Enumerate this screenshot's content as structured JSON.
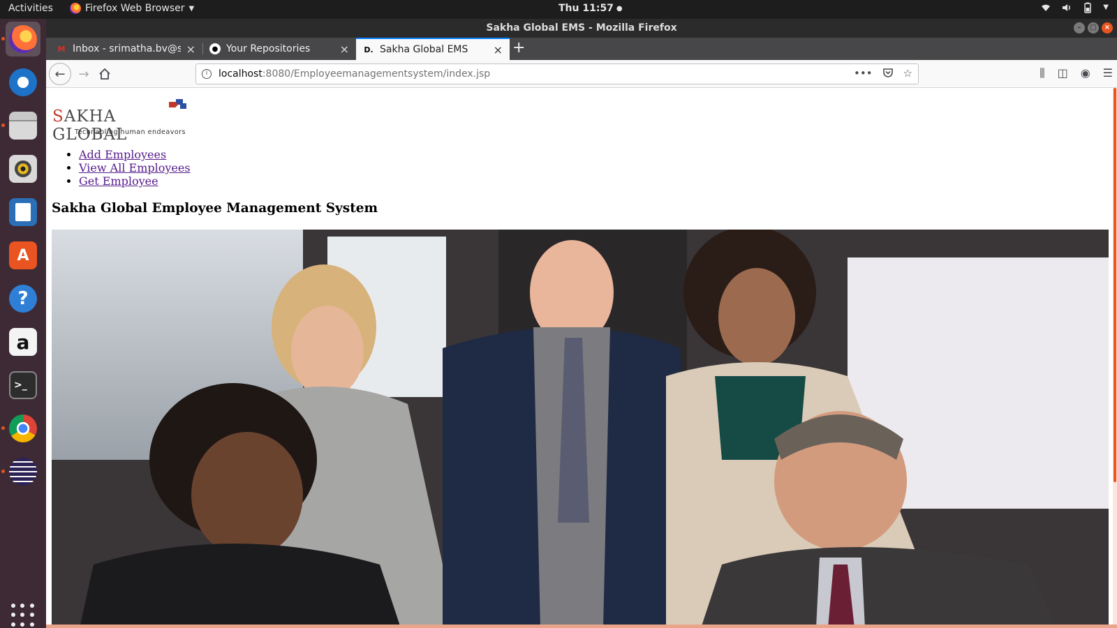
{
  "topbar": {
    "activities": "Activities",
    "app_name": "Firefox Web Browser",
    "clock": "Thu 11:57"
  },
  "dock": {
    "items": [
      {
        "name": "firefox-icon",
        "active": true
      },
      {
        "name": "thunderbird-icon",
        "active": false
      },
      {
        "name": "files-icon",
        "active": false
      },
      {
        "name": "rhythmbox-icon",
        "active": false
      },
      {
        "name": "libreoffice-writer-icon",
        "active": false
      },
      {
        "name": "software-center-icon",
        "active": false
      },
      {
        "name": "help-icon",
        "active": false
      },
      {
        "name": "amazon-icon",
        "active": false
      },
      {
        "name": "terminal-icon",
        "active": false
      },
      {
        "name": "chrome-icon",
        "active": false
      },
      {
        "name": "eclipse-icon",
        "active": false
      }
    ]
  },
  "window": {
    "title": "Sakha Global EMS - Mozilla Firefox"
  },
  "tabs": [
    {
      "label": "Inbox - srimatha.bv@sak",
      "favicon": "gmail-icon"
    },
    {
      "label": "Your Repositories",
      "favicon": "github-icon"
    },
    {
      "label": "Sakha Global EMS",
      "favicon": "D.",
      "selected": true
    }
  ],
  "urlbar": {
    "host": "localhost",
    "path": ":8080/Employeemanagementsystem/index.jsp"
  },
  "page": {
    "logo_brand_first": "S",
    "logo_brand_rest": "AKHA GLOBAL",
    "logo_tagline": "Technabling human endeavors",
    "nav_links": [
      "Add Employees",
      "View All Employees",
      "Get Employee"
    ],
    "title": "Sakha Global Employee Management System"
  },
  "colors": {
    "accent": "#e95420",
    "link_visited": "#551a8b",
    "tab_highlight": "#0a84ff"
  }
}
